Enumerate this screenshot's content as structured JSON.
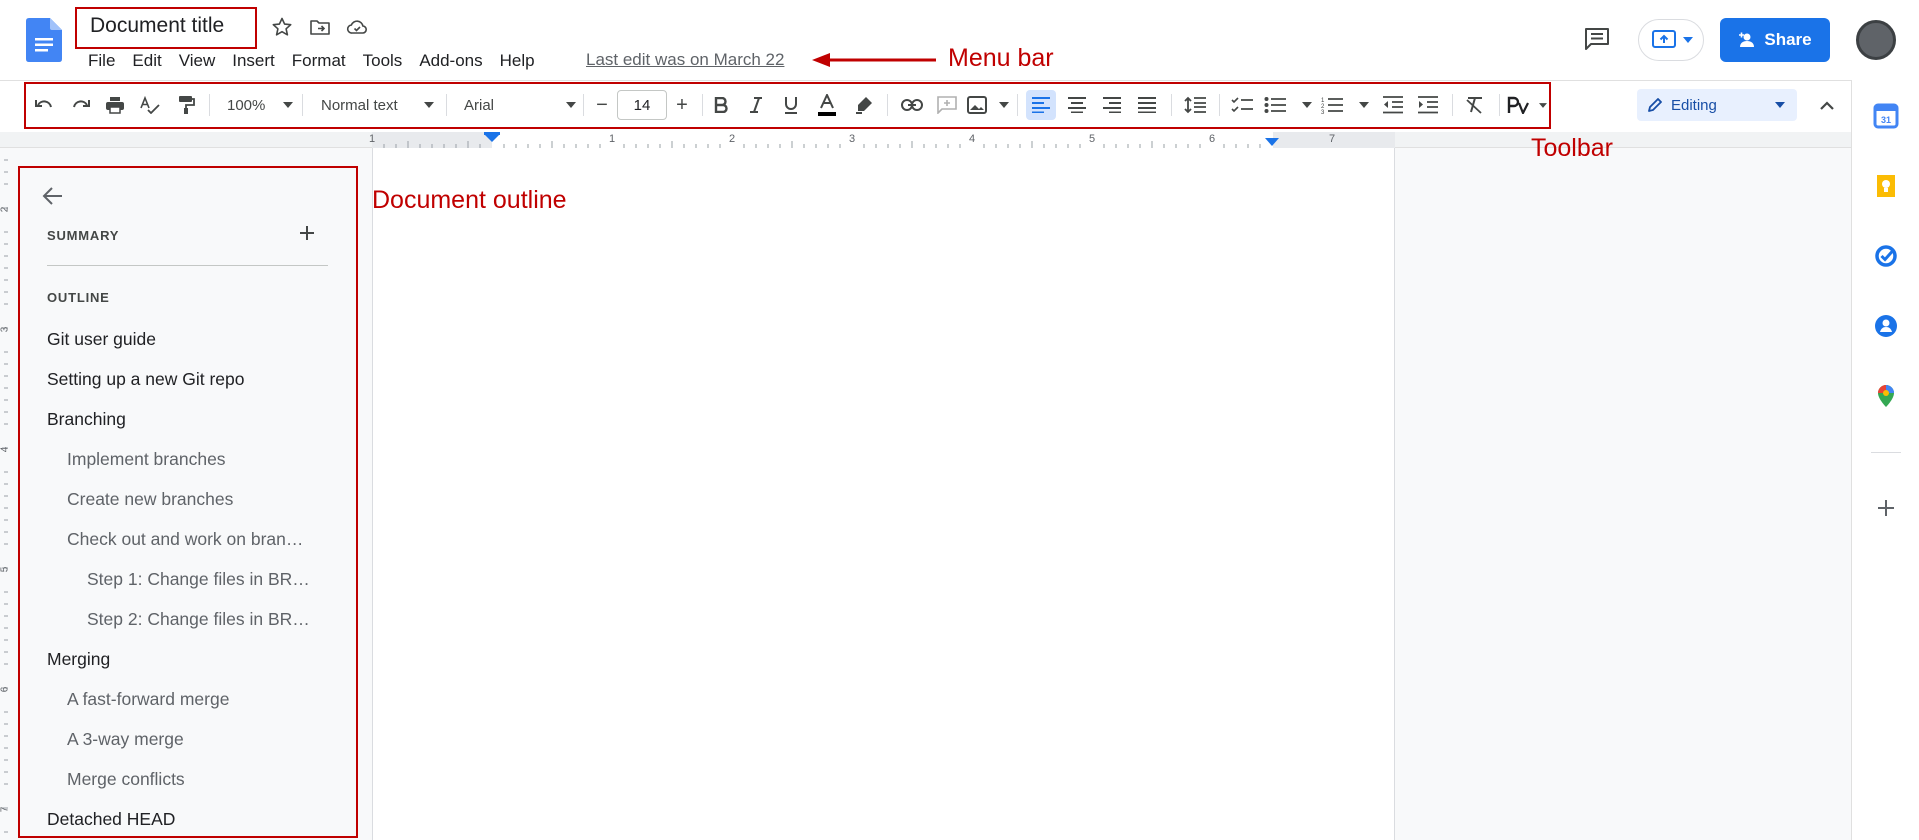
{
  "document": {
    "title": "Document title",
    "last_edit": "Last edit was on March 22"
  },
  "menu": [
    "File",
    "Edit",
    "View",
    "Insert",
    "Format",
    "Tools",
    "Add-ons",
    "Help"
  ],
  "header": {
    "share_label": "Share"
  },
  "toolbar": {
    "zoom": "100%",
    "style": "Normal text",
    "font": "Arial",
    "font_size": "14",
    "mode": "Editing",
    "font_size_minus": "−",
    "font_size_plus": "+"
  },
  "ruler": {
    "numbers": [
      "1",
      "1",
      "2",
      "3",
      "4",
      "5",
      "6",
      "7"
    ],
    "vertical_numbers": [
      "2",
      "3",
      "4",
      "5",
      "6",
      "7"
    ]
  },
  "outline_panel": {
    "summary_label": "SUMMARY",
    "outline_label": "OUTLINE",
    "items": [
      {
        "text": "Git user guide",
        "level": 1
      },
      {
        "text": "Setting up a new Git repo",
        "level": 1
      },
      {
        "text": "Branching",
        "level": 1
      },
      {
        "text": "Implement branches",
        "level": 2
      },
      {
        "text": "Create new branches",
        "level": 2
      },
      {
        "text": "Check out and work on bran…",
        "level": 2
      },
      {
        "text": "Step 1: Change files in BR…",
        "level": 3
      },
      {
        "text": "Step 2: Change files in BR…",
        "level": 3
      },
      {
        "text": "Merging",
        "level": 1
      },
      {
        "text": "A fast-forward merge",
        "level": 2
      },
      {
        "text": "A 3-way merge",
        "level": 2
      },
      {
        "text": "Merge conflicts",
        "level": 2
      },
      {
        "text": "Detached HEAD",
        "level": 1
      }
    ]
  },
  "annotations": {
    "menu_bar": "Menu bar",
    "toolbar": "Toolbar",
    "document_outline": "Document outline"
  },
  "colors": {
    "accent": "#1a73e8",
    "annotation": "#c00000",
    "editing_bg": "#e8f0fe"
  },
  "side_panel_icons": [
    "calendar-icon",
    "keep-icon",
    "tasks-icon",
    "contacts-icon",
    "maps-icon",
    "add-icon"
  ]
}
